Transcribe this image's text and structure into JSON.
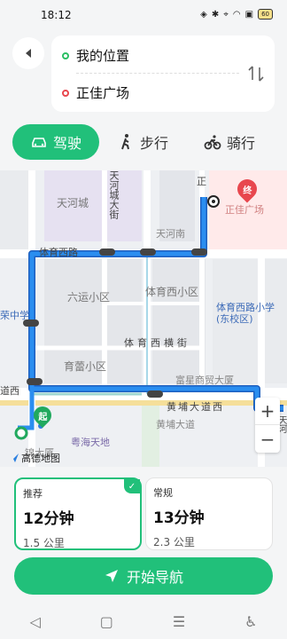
{
  "status": {
    "time": "18:12",
    "battery": "60"
  },
  "route": {
    "origin": "我的位置",
    "destination": "正佳广场"
  },
  "modes": [
    {
      "label": "驾驶",
      "icon": "car-icon",
      "active": true
    },
    {
      "label": "步行",
      "icon": "walk-icon",
      "active": false
    },
    {
      "label": "骑行",
      "icon": "bike-icon",
      "active": false
    }
  ],
  "map": {
    "labels": {
      "tianhecheng": "天河城",
      "tianhedajie": "天河城大街",
      "tianhenan": "天河南",
      "tiyuxilu": "体育西路",
      "liuyun": "六运小区",
      "tiyuxi_xiaoqu": "体育西小区",
      "rongzhong": "荣中学",
      "tiyuxi_school": "体育西路小学(东校区)",
      "tiyuxi_hengjie": "体育西横街",
      "yulei": "育蕾小区",
      "fuxian": "富星商贸大厦",
      "daodong": "道西",
      "huangpu": "黄埔大道西",
      "huangpu_stop": "黄埔大道",
      "yuehai": "粤海天地",
      "zheng_road": "正",
      "target": "正佳广场",
      "side_road": "天河",
      "jingdasha": "锦大厦",
      "gaode": "高德地图"
    },
    "start_pin": "起",
    "end_pin": "终"
  },
  "options": [
    {
      "tag": "推荐",
      "time": "12分钟",
      "distance": "1.5 公里",
      "selected": true
    },
    {
      "tag": "常规",
      "time": "13分钟",
      "distance": "2.3 公里",
      "selected": false
    }
  ],
  "start_button": "开始导航",
  "colors": {
    "accent": "#21c07a",
    "route": "#2a7fe0",
    "origin": "#2bbf63",
    "destination": "#e8474e"
  }
}
